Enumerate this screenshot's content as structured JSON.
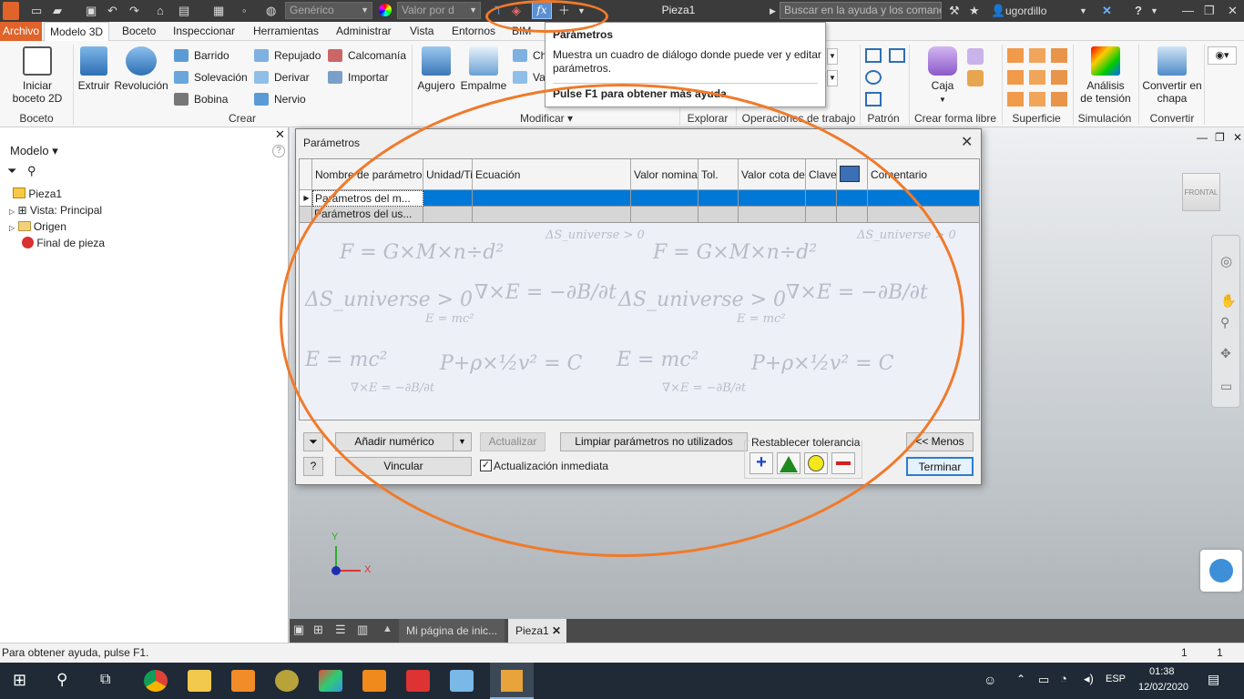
{
  "app": {
    "window_title": "Pieza1",
    "material_combo": "Genérico",
    "appearance_combo": "Valor por d",
    "help_search_placeholder": "Buscar en la ayuda y los comanc",
    "user": "ugordillo"
  },
  "menu": {
    "tabs": [
      "Archivo",
      "Modelo 3D",
      "Boceto",
      "Inspeccionar",
      "Herramientas",
      "Administrar",
      "Vista",
      "Entornos",
      "BIM"
    ],
    "active": "Modelo 3D"
  },
  "ribbon": {
    "boceto": {
      "button": "Iniciar boceto 2D",
      "line1": "Iniciar",
      "line2": "boceto 2D",
      "panel": "Boceto"
    },
    "crear": {
      "extruir": "Extruir",
      "revolucion": "Revolución",
      "small": [
        "Barrido",
        "Solevación",
        "Bobina",
        "Repujado",
        "Derivar",
        "Nervio",
        "Calcomanía",
        "Importar"
      ],
      "panel": "Crear"
    },
    "modificar": {
      "agujero": "Agujero",
      "empalme": "Empalme",
      "chaflan_stub": "Ch",
      "vaciado_stub": "Va",
      "panel": "Modificar"
    },
    "panels_right": [
      "Explorar",
      "Operaciones de trabajo",
      "Patrón",
      "Crear forma libre",
      "Superficie",
      "Simulación",
      "Convertir"
    ],
    "caja": "Caja",
    "analisis": {
      "line1": "Análisis",
      "line2": "de tensión"
    },
    "convertir": {
      "line1": "Convertir en",
      "line2": "chapa"
    }
  },
  "tooltip": {
    "title": "Parámetros",
    "body": "Muestra un cuadro de diálogo donde puede ver y editar parámetros.",
    "help": "Pulse F1 para obtener más ayuda"
  },
  "browser": {
    "title": "Modelo",
    "items": [
      "Pieza1",
      "Vista: Principal",
      "Origen",
      "Final de pieza"
    ]
  },
  "viewcube": {
    "face": "FRONTAL"
  },
  "dialog": {
    "title": "Parámetros",
    "columns": [
      "Nombre de parámetro",
      "Unidad/Tip",
      "Ecuación",
      "Valor nominal",
      "Tol.",
      "Valor cota del",
      "Clave",
      "",
      "Comentario"
    ],
    "rows": [
      "Parámetros del m...",
      "Parámetros del us..."
    ],
    "buttons": {
      "add_numeric": "Añadir numérico",
      "update": "Actualizar",
      "purge": "Limpiar parámetros no utilizados",
      "link": "Vincular",
      "immediate_update": "Actualización inmediata",
      "less": "<< Menos",
      "done": "Terminar"
    },
    "reset_tolerance": "Restablecer tolerancia",
    "watermark": [
      "F = G×M×n÷d²",
      "ΔS_universe > 0",
      "∇×E = −∂B/∂t",
      "E = mc²",
      "P+ρ×½v² = C"
    ]
  },
  "doc_tabs": [
    "Mi página de inic...",
    "Pieza1"
  ],
  "axes": {
    "x": "X",
    "y": "Y"
  },
  "status": {
    "text": "Para obtener ayuda, pulse F1.",
    "count1": "1",
    "count2": "1"
  },
  "taskbar": {
    "time": "01:38",
    "date": "12/02/2020",
    "lang": "ESP"
  },
  "colors": {
    "accent": "#e0632a",
    "selection": "#0078d7",
    "annotation": "#f07a2a"
  }
}
